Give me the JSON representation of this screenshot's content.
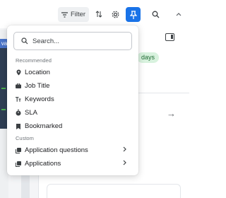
{
  "toolbar": {
    "filter_label": "Filter",
    "icons": [
      "filter-icon",
      "sort-icon",
      "settings-icon",
      "pin-icon",
      "search-icon",
      "chevron-up-icon"
    ],
    "accent": "#1a73e8"
  },
  "background": {
    "left_pill_text": "vai",
    "badge_text": "days",
    "badge_color": "#d8f2de"
  },
  "dropdown": {
    "search_placeholder": "Search...",
    "sections": {
      "recommended": "Recommended",
      "custom": "Custom"
    },
    "recommended_items": [
      {
        "label": "Location",
        "icon": "location-pin-icon"
      },
      {
        "label": "Job Title",
        "icon": "briefcase-icon"
      },
      {
        "label": "Keywords",
        "icon": "text-icon"
      },
      {
        "label": "SLA",
        "icon": "timer-icon"
      },
      {
        "label": "Bookmarked",
        "icon": "bookmark-icon"
      }
    ],
    "custom_items": [
      {
        "label": "Application questions",
        "icon": "stack-icon",
        "has_submenu": true
      },
      {
        "label": "Applications",
        "icon": "stack-icon",
        "has_submenu": true
      }
    ]
  }
}
